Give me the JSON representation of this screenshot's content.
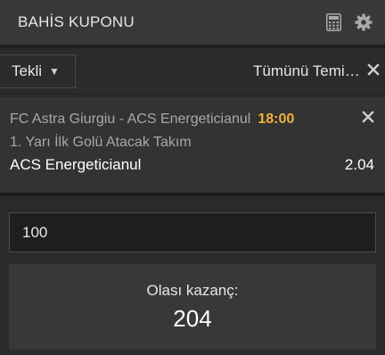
{
  "header": {
    "title": "BAHİS KUPONU",
    "icons": [
      "calculator-icon",
      "gear-icon"
    ]
  },
  "toolbar": {
    "bet_type": "Tekli",
    "clear_all_label": "Tümünü Temizle"
  },
  "selection": {
    "match": "FC Astra Giurgiu - ACS Energeticianul",
    "time": "18:00",
    "market": "1. Yarı İlk Golü Atacak Takım",
    "pick": "ACS Energeticianul",
    "odds": "2.04"
  },
  "stake": {
    "value": "100"
  },
  "potential_win": {
    "label": "Olası kazanç:",
    "value": "204"
  },
  "colors": {
    "accent_time": "#f0b23a",
    "background": "#2b2b2b",
    "header": "#383838"
  }
}
